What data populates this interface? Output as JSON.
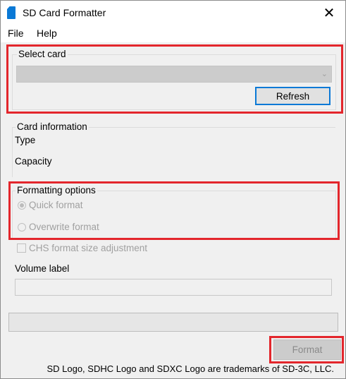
{
  "window": {
    "title": "SD Card Formatter",
    "close_glyph": "✕"
  },
  "menu": {
    "items": [
      {
        "label": "File"
      },
      {
        "label": "Help"
      }
    ]
  },
  "select_card": {
    "title": "Select card",
    "selected_value": "",
    "refresh_label": "Refresh"
  },
  "card_info": {
    "title": "Card information",
    "type_label": "Type",
    "capacity_label": "Capacity"
  },
  "formatting_options": {
    "title": "Formatting options",
    "quick_format_label": "Quick format",
    "quick_format_selected": true,
    "overwrite_format_label": "Overwrite format",
    "overwrite_format_selected": false
  },
  "chs": {
    "label": "CHS format size adjustment",
    "checked": false
  },
  "volume_label": {
    "label": "Volume label",
    "value": ""
  },
  "progress": {
    "value": 0
  },
  "format_button": {
    "label": "Format"
  },
  "footer": {
    "trademark": "SD Logo, SDHC Logo and SDXC Logo are trademarks of SD-3C, LLC."
  },
  "icons": {
    "app": "sd-card-icon",
    "close": "close-icon",
    "dropdown": "chevron-down-icon"
  },
  "colors": {
    "highlight": "#e3262c",
    "accent": "#0a79d6",
    "disabled_text": "#a0a0a0"
  }
}
